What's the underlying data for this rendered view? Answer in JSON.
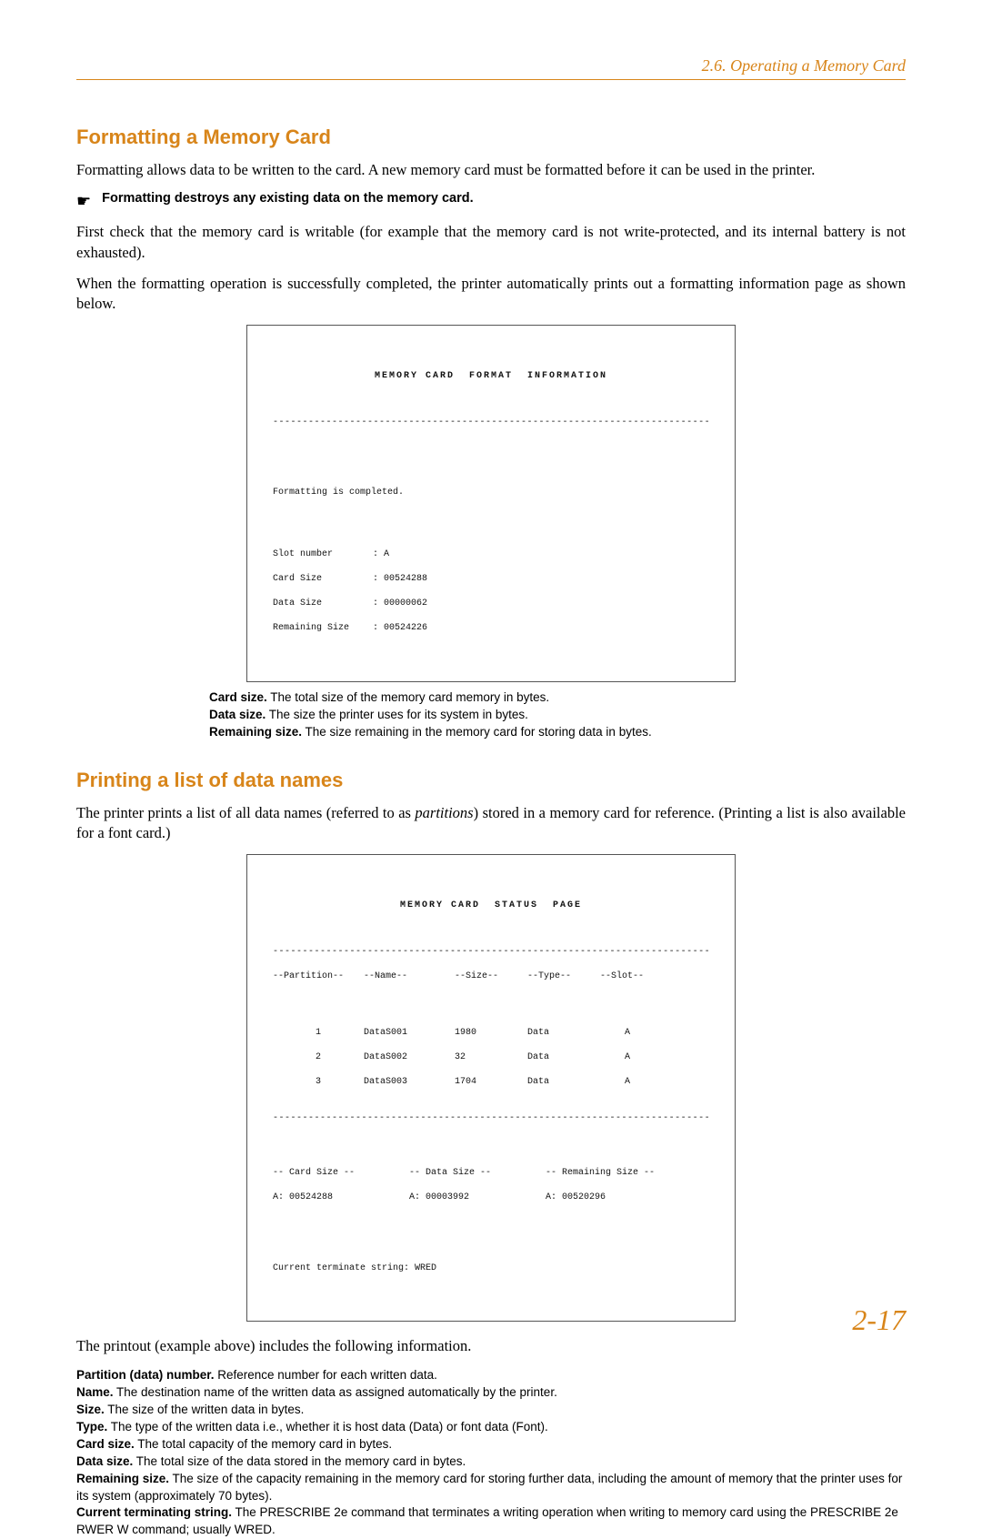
{
  "header": {
    "breadcrumb": "2.6. Operating a Memory Card"
  },
  "section1": {
    "title": "Formatting a Memory Card",
    "p1": "Formatting allows data to be written to the card. A new memory card must be formatted before it can be used in the printer.",
    "warning": "Formatting destroys any existing data on the memory card.",
    "p2": "First check that the memory card is writable (for example that the memory card is not write-protected, and its internal battery is not exhausted).",
    "p3": "When the formatting operation is successfully completed, the printer automatically prints out a formatting information page as shown below.",
    "printout": {
      "title": "MEMORY CARD  FORMAT  INFORMATION",
      "line_complete": "Formatting is completed.",
      "rows": [
        {
          "k": "Slot number",
          "v": ": A"
        },
        {
          "k": "Card Size",
          "v": ": 00524288"
        },
        {
          "k": "Data Size",
          "v": ": 00000062"
        },
        {
          "k": "Remaining Size",
          "v": ": 00524226"
        }
      ]
    },
    "caption": {
      "card_size_k": "Card size.",
      "card_size_v": " The total size of the memory card memory in bytes.",
      "data_size_k": "Data size.",
      "data_size_v": " The size the printer uses for its system in bytes.",
      "remaining_k": "Remaining size.",
      "remaining_v": " The size remaining in the memory card for storing data in bytes."
    }
  },
  "section2": {
    "title": "Printing a list of data names",
    "p1a": "The printer prints a list of all data names (referred to as ",
    "p1it": "partitions",
    "p1b": ") stored in a memory card for reference. (Printing a list is also available for a font card.)",
    "printout": {
      "title": "MEMORY CARD  STATUS  PAGE",
      "headers": {
        "partition": "--Partition--",
        "name": "--Name--",
        "size": "--Size--",
        "type": "--Type--",
        "slot": "--Slot--"
      },
      "rows": [
        {
          "p": "1",
          "n": "DataS001",
          "s": "1980",
          "t": "Data",
          "sl": "A"
        },
        {
          "p": "2",
          "n": "DataS002",
          "s": "32",
          "t": "Data",
          "sl": "A"
        },
        {
          "p": "3",
          "n": "DataS003",
          "s": "1704",
          "t": "Data",
          "sl": "A"
        }
      ],
      "footer_labels": {
        "cs": "-- Card Size --",
        "ds": "-- Data Size --",
        "rs": "-- Remaining Size --"
      },
      "footer_values": {
        "cs": "A: 00524288",
        "ds": "A: 00003992",
        "rs": "A: 00520296"
      },
      "terminate": "Current terminate string: WRED"
    },
    "p2": "The printout (example above) includes the following information.",
    "defs": [
      {
        "k": "Partition (data) number.",
        "v": " Reference number for each written data."
      },
      {
        "k": "Name.",
        "v": " The destination name of the written data as assigned automatically by the printer."
      },
      {
        "k": "Size.",
        "v": " The size of the written data in bytes."
      },
      {
        "k": "Type.",
        "v": " The type of the written data i.e., whether it is host data (Data) or font data (Font)."
      },
      {
        "k": "Card size.",
        "v": " The total capacity of the memory card in bytes."
      },
      {
        "k": "Data size.",
        "v": " The total size of the data stored in the memory card in bytes."
      },
      {
        "k": "Remaining size.",
        "v": " The size of the capacity remaining in the memory card for storing further data, including the amount of memory that the printer uses for its system (approximately 70 bytes)."
      },
      {
        "k": "Current terminating string.",
        "v": " The PRESCRIBE 2e command that terminates a writing operation when writing to memory card using the PRESCRIBE 2e RWER W command; usually WRED."
      }
    ]
  },
  "page_number": "2-17"
}
